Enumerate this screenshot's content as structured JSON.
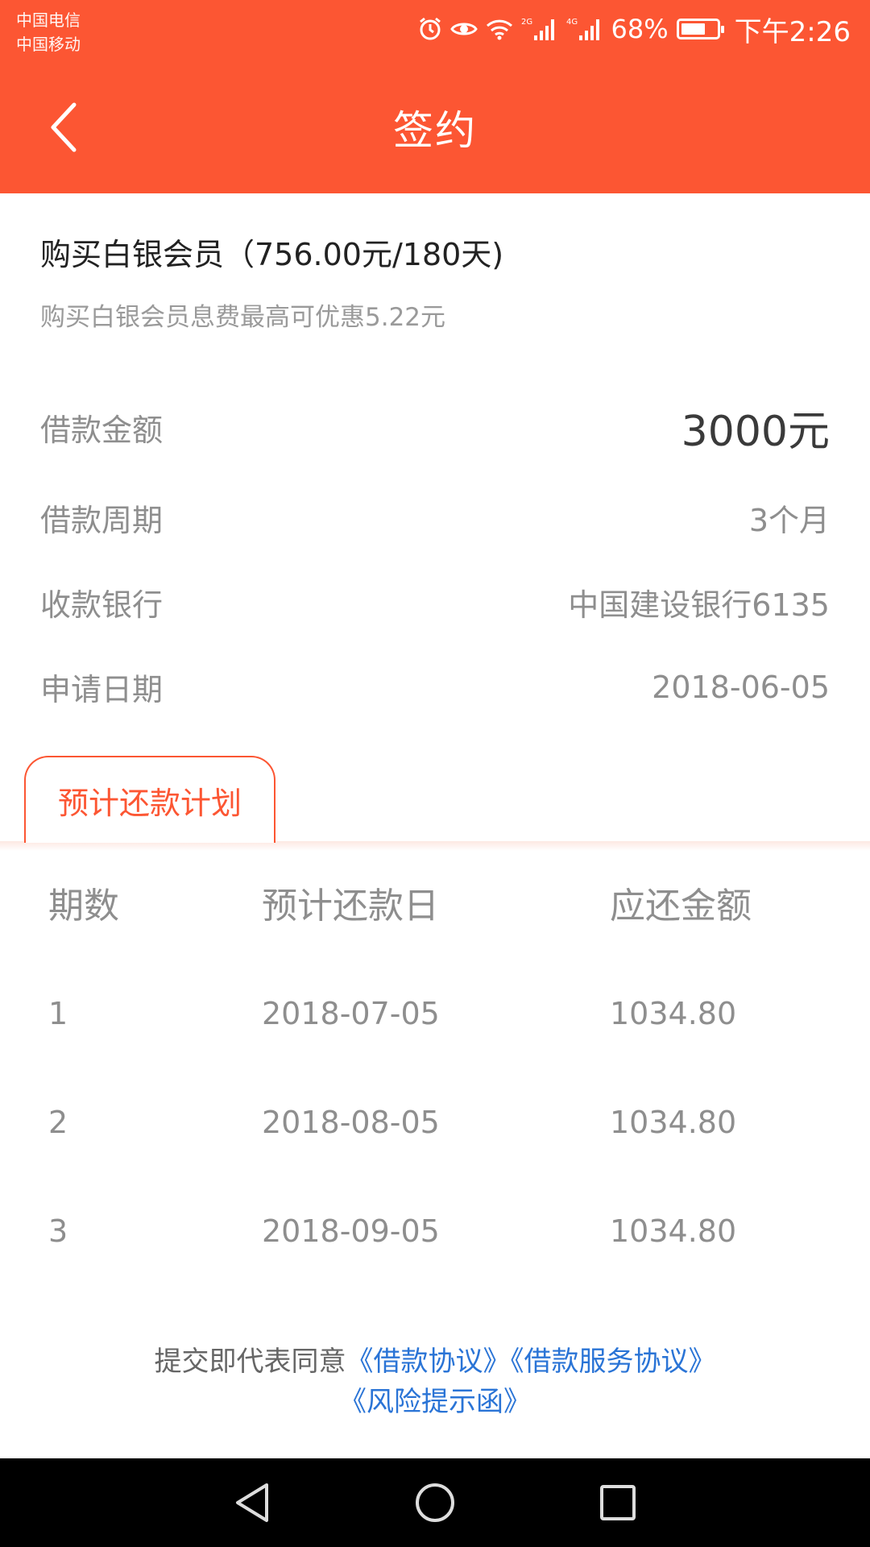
{
  "status_bar": {
    "carrier_1": "中国电信",
    "carrier_2": "中国移动",
    "network_1": "2G",
    "network_2": "4G",
    "battery_percent": "68%",
    "battery_level": 0.68,
    "time": "下午2:26"
  },
  "header": {
    "title": "签约",
    "back_icon": "chevron-left-icon"
  },
  "membership": {
    "title": "购买白银会员（756.00元/180天)",
    "subtitle": "购买白银会员息费最高可优惠5.22元"
  },
  "loan_info": [
    {
      "label": "借款金额",
      "value": "3000元"
    },
    {
      "label": "借款周期",
      "value": "3个月"
    },
    {
      "label": "收款银行",
      "value": "中国建设银行6135"
    },
    {
      "label": "申请日期",
      "value": "2018-06-05"
    }
  ],
  "plan": {
    "tab_label": "预计还款计划",
    "columns": [
      "期数",
      "预计还款日",
      "应还金额"
    ],
    "rows": [
      {
        "period": "1",
        "date": "2018-07-05",
        "amount": "1034.80"
      },
      {
        "period": "2",
        "date": "2018-08-05",
        "amount": "1034.80"
      },
      {
        "period": "3",
        "date": "2018-09-05",
        "amount": "1034.80"
      }
    ]
  },
  "agreement": {
    "prefix": "提交即代表同意",
    "links": [
      "《借款协议》",
      "《借款服务协议》",
      "《风险提示函》"
    ]
  },
  "colors": {
    "brand": "#fc5633",
    "link": "#2a74d6"
  },
  "navbar": {
    "icons": [
      "back-triangle-icon",
      "home-circle-icon",
      "recents-square-icon"
    ]
  }
}
